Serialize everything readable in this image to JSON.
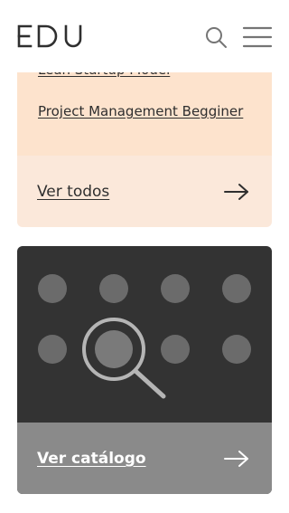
{
  "header": {
    "logo_text": "EDU",
    "search_icon": "search-icon",
    "menu_icon": "hamburger-menu-icon"
  },
  "courses": {
    "items": [
      {
        "label": "Lean Startup Model"
      },
      {
        "label": "Project Management Begginer"
      }
    ],
    "see_all_label": "Ver todos",
    "see_all_icon": "arrow-right-icon"
  },
  "catalog": {
    "illustration": "search-catalog-illustration",
    "label": "Ver catálogo",
    "icon": "arrow-right-icon"
  },
  "colors": {
    "accent_light": "#fde3cd",
    "accent_footer": "#fbe8da",
    "dark_card": "#333333",
    "catalog_footer": "#8a8a8a",
    "text": "#2f2f2f"
  }
}
